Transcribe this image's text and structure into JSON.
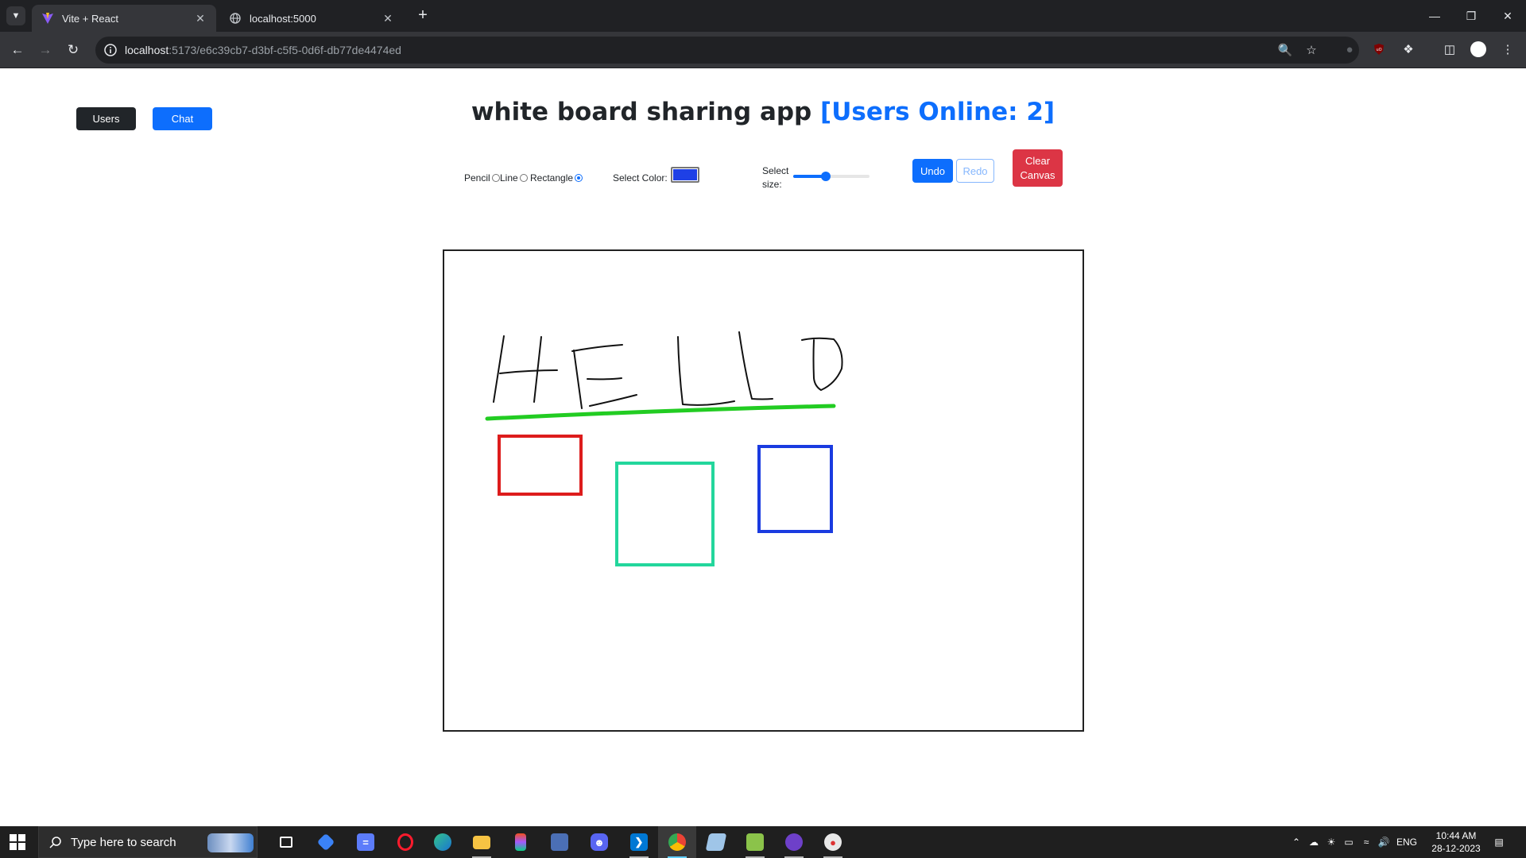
{
  "browser": {
    "tabs": [
      {
        "title": "Vite + React",
        "icon": "vite-icon",
        "active": true
      },
      {
        "title": "localhost:5000",
        "icon": "globe-icon",
        "active": false
      }
    ],
    "url_host": "localhost",
    "url_path": ":5173/e6c39cb7-d3bf-c5f5-0d6f-db77de4474ed"
  },
  "header": {
    "users_button": "Users",
    "chat_button": "Chat",
    "title": "white board sharing app",
    "online": "[Users Online: 2]"
  },
  "tools": {
    "options": [
      {
        "label": "Pencil",
        "checked": false
      },
      {
        "label": "Line",
        "checked": false
      },
      {
        "label": "Rectangle",
        "checked": true
      }
    ],
    "color_label": "Select Color:",
    "selected_color": "#1e40e6",
    "size_label": "Select size:",
    "size_fraction": 0.43,
    "undo": "Undo",
    "redo": "Redo",
    "clear": "Clear\nCanvas"
  },
  "canvas": {
    "colors": {
      "ink": "#111111",
      "underline": "#22cc22",
      "red": "#dd1c1c",
      "teal": "#23d69c",
      "blue": "#1a3be0"
    },
    "pencil_text": "HELLO"
  },
  "taskbar": {
    "search_placeholder": "Type here to search",
    "language": "ENG",
    "time": "10:44 AM",
    "date": "28-12-2023"
  }
}
